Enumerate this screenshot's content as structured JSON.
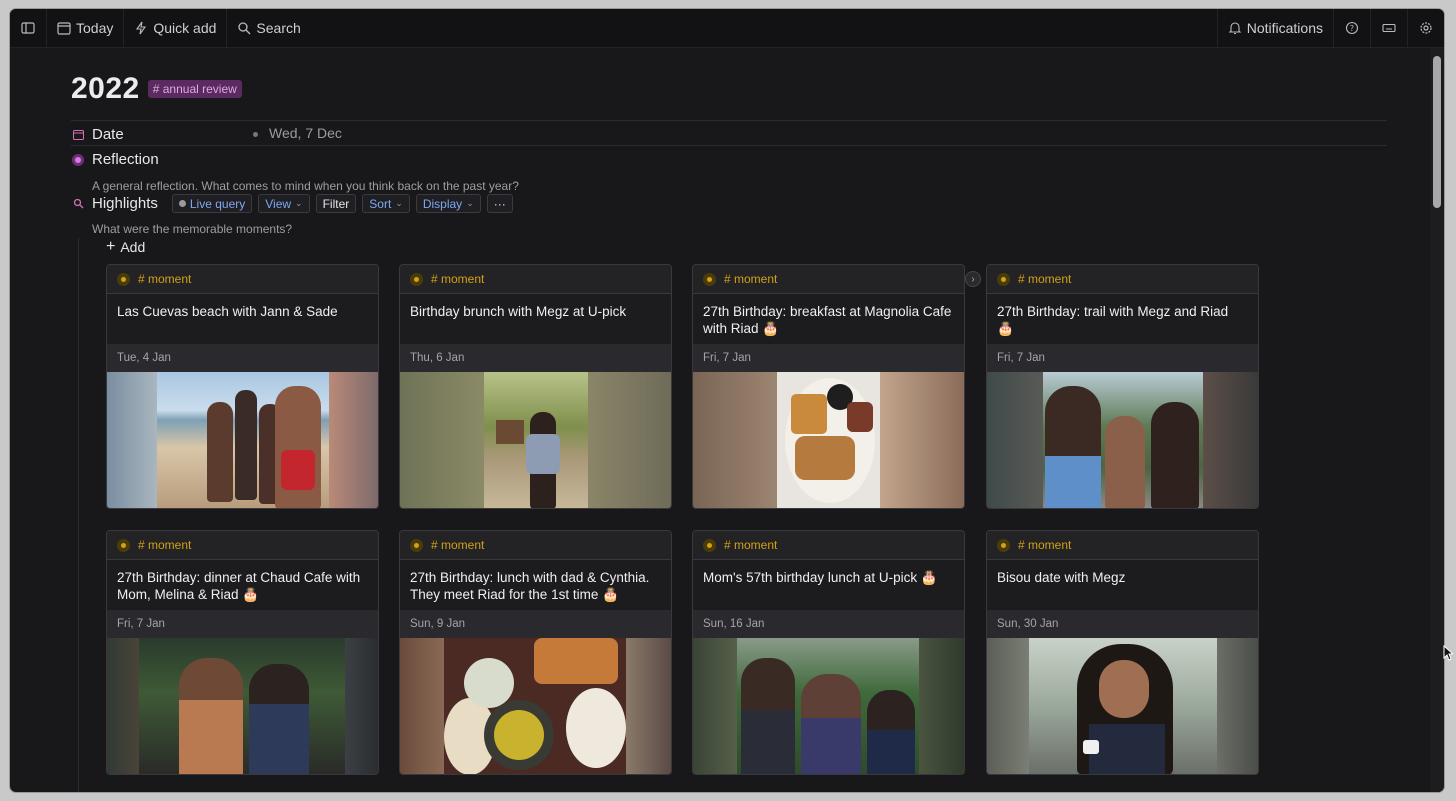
{
  "topbar": {
    "today": "Today",
    "quick_add": "Quick add",
    "search": "Search",
    "notifications": "Notifications"
  },
  "page": {
    "title": "2022",
    "tag": "# annual review"
  },
  "fields": {
    "date_label": "Date",
    "date_value": "Wed, 7 Dec",
    "reflection_label": "Reflection",
    "reflection_desc": "A general reflection. What comes to mind when you think back on the past year?",
    "highlights_label": "Highlights",
    "highlights_desc": "What were the memorable moments?"
  },
  "toolbar": {
    "live_query": "Live query",
    "view": "View",
    "filter": "Filter",
    "sort": "Sort",
    "display": "Display",
    "more": "···"
  },
  "add_label": "Add",
  "colors": {
    "moment": "#d3a114",
    "annual_tag_bg": "#5b2a5e",
    "accent_blue": "#7fa8f0"
  },
  "cards": [
    {
      "tag": "# moment",
      "title": "Las Cuevas beach with Jann & Sade",
      "date": "Tue, 4 Jan",
      "photo": "beach group selfie"
    },
    {
      "tag": "# moment",
      "title": "Birthday brunch with Megz at U-pick",
      "date": "Thu, 6 Jan",
      "photo": "woman under bamboo"
    },
    {
      "tag": "# moment",
      "title": "27th Birthday: breakfast at Magnolia Cafe with Riad 🎂",
      "date": "Fri, 7 Jan",
      "photo": "waffle plate"
    },
    {
      "tag": "# moment",
      "title": "27th Birthday: trail with Megz and Riad 🎂",
      "date": "Fri, 7 Jan",
      "photo": "trail selfie"
    },
    {
      "tag": "# moment",
      "title": "27th Birthday: dinner at Chaud Cafe with Mom, Melina & Riad 🎂",
      "date": "Fri, 7 Jan",
      "photo": "dinner photo"
    },
    {
      "tag": "# moment",
      "title": "27th Birthday: lunch with dad & Cynthia. They meet Riad for the 1st time 🎂",
      "date": "Sun, 9 Jan",
      "photo": "lunch dishes"
    },
    {
      "tag": "# moment",
      "title": "Mom's 57th birthday lunch at U-pick 🎂",
      "date": "Sun, 16 Jan",
      "photo": "three women"
    },
    {
      "tag": "# moment",
      "title": "Bisou date with Megz",
      "date": "Sun, 30 Jan",
      "photo": "woman with cup"
    }
  ]
}
